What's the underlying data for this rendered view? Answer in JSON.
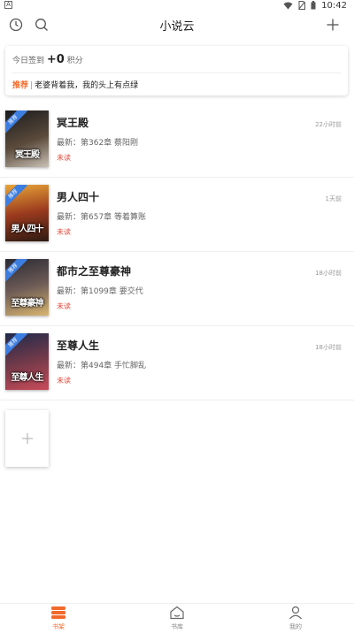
{
  "status_bar": {
    "left_icon_label": "A",
    "time": "10:42"
  },
  "header": {
    "title": "小说云",
    "left_icons": [
      "clock-icon",
      "search-icon"
    ],
    "right_icon": "plus-icon"
  },
  "signin": {
    "prefix": "今日签到",
    "points": "+0",
    "suffix": "积分"
  },
  "recommend": {
    "tag": "推荐",
    "separator": "|",
    "text": "老婆背着我，我的头上有点绿"
  },
  "books": [
    {
      "title": "冥王殿",
      "latest": "最新：第362章 蔡阳刚",
      "status": "未读",
      "time": "22小时前",
      "cover_text": "冥王殿",
      "cover_ribbon": "推荐",
      "cover_colors": [
        "#1b1b1d",
        "#5a4a3b",
        "#c9c1b5"
      ]
    },
    {
      "title": "男人四十",
      "latest": "最新：第657章 等着算账",
      "status": "未读",
      "time": "1天前",
      "cover_text": "男人四十",
      "cover_ribbon": "推荐",
      "cover_colors": [
        "#e8a537",
        "#9a3a1e",
        "#2d1a12"
      ]
    },
    {
      "title": "都市之至尊豪神",
      "latest": "最新：第1099章 要交代",
      "status": "未读",
      "time": "18小时前",
      "cover_text": "至尊豪神",
      "cover_ribbon": "推荐",
      "cover_colors": [
        "#2a2a34",
        "#6d5b56",
        "#d9b56f"
      ]
    },
    {
      "title": "至尊人生",
      "latest": "最新：第494章 手忙脚乱",
      "status": "未读",
      "time": "18小时前",
      "cover_text": "至尊人生",
      "cover_ribbon": "推荐",
      "cover_colors": [
        "#1f2a4a",
        "#7a3b4a",
        "#c94b5a"
      ]
    }
  ],
  "add_card": {
    "icon": "plus-icon"
  },
  "bottom_nav": [
    {
      "label": "书架",
      "icon": "bookshelf-icon",
      "active": true
    },
    {
      "label": "书库",
      "icon": "home-icon",
      "active": false
    },
    {
      "label": "我的",
      "icon": "profile-icon",
      "active": false
    }
  ],
  "colors": {
    "accent": "#f26a2b",
    "unread": "#e04a3b",
    "ribbon": "#3c7de0"
  }
}
